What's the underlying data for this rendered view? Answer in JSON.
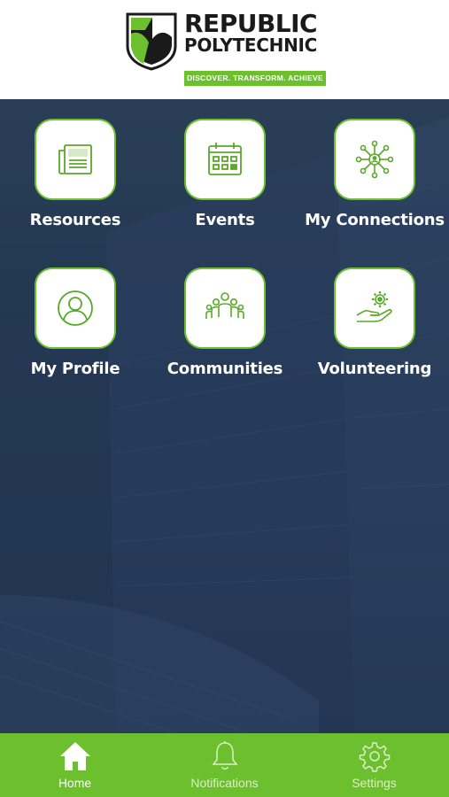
{
  "brand": {
    "line1": "REPUBLIC",
    "line2": "POLYTECHNIC",
    "tagline": "DISCOVER. TRANSFORM. ACHIEVE",
    "accent": "#6cbf2d",
    "dark": "#1d3047"
  },
  "menu": {
    "items": [
      {
        "label": "Resources",
        "icon": "newspaper-icon"
      },
      {
        "label": "Events",
        "icon": "calendar-icon"
      },
      {
        "label": "My Connections",
        "icon": "network-icon"
      },
      {
        "label": "My Profile",
        "icon": "user-circle-icon"
      },
      {
        "label": "Communities",
        "icon": "people-group-icon"
      },
      {
        "label": "Volunteering",
        "icon": "hand-gear-icon"
      }
    ]
  },
  "tabbar": {
    "tabs": [
      {
        "label": "Home",
        "icon": "home-icon",
        "active": true
      },
      {
        "label": "Notifications",
        "icon": "bell-icon",
        "active": false
      },
      {
        "label": "Settings",
        "icon": "gear-icon",
        "active": false
      }
    ]
  }
}
